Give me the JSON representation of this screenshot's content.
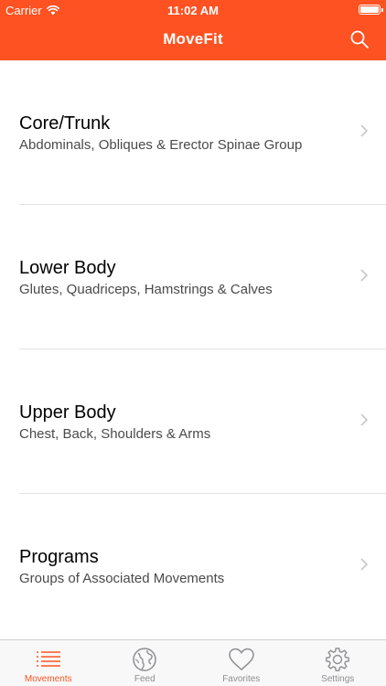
{
  "colors": {
    "accent": "#FE5222",
    "inactive": "#8E8E93"
  },
  "status_bar": {
    "carrier": "Carrier",
    "time": "11:02 AM"
  },
  "header": {
    "title": "MoveFit",
    "search_icon": "search-icon"
  },
  "categories": [
    {
      "title": "Core/Trunk",
      "subtitle": "Abdominals, Obliques & Erector Spinae Group"
    },
    {
      "title": "Lower Body",
      "subtitle": "Glutes, Quadriceps, Hamstrings & Calves"
    },
    {
      "title": "Upper Body",
      "subtitle": "Chest, Back, Shoulders & Arms"
    },
    {
      "title": "Programs",
      "subtitle": "Groups of Associated Movements"
    }
  ],
  "tabbar": {
    "active": "Movements",
    "tabs": [
      {
        "label": "Movements",
        "icon": "list-icon"
      },
      {
        "label": "Feed",
        "icon": "globe-icon"
      },
      {
        "label": "Favorites",
        "icon": "heart-icon"
      },
      {
        "label": "Settings",
        "icon": "gear-icon"
      }
    ]
  }
}
